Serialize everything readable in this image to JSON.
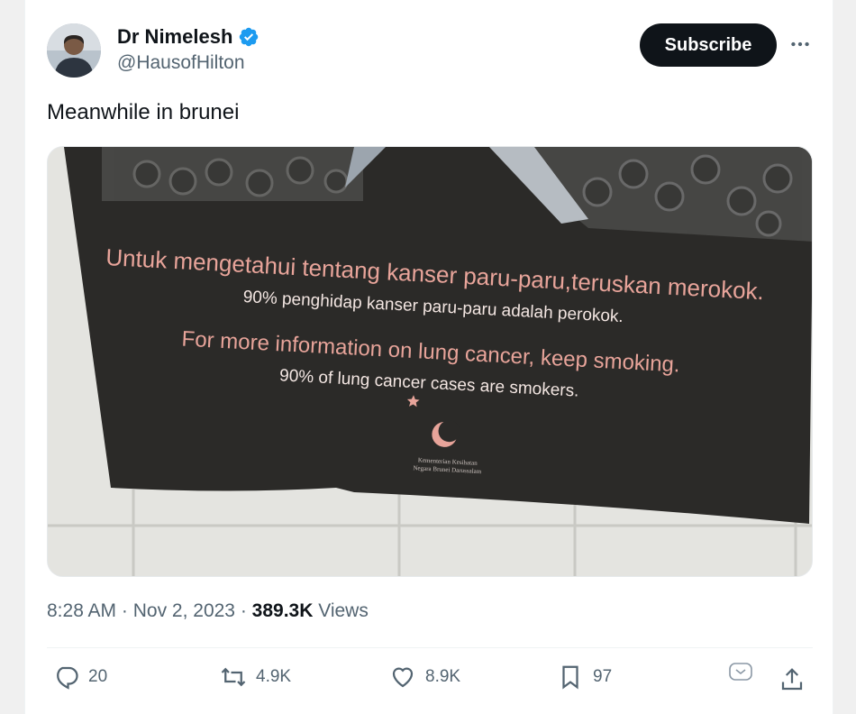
{
  "author": {
    "name": "Dr Nimelesh",
    "handle": "@HausofHilton",
    "verified_icon": "verified-badge-icon"
  },
  "header": {
    "subscribe_label": "Subscribe",
    "more_icon": "more-options-icon"
  },
  "tweet": {
    "text": "Meanwhile in brunei"
  },
  "media": {
    "poster": {
      "line1": "Untuk mengetahui tentang kanser paru-paru,teruskan merokok.",
      "line2": "90% penghidap kanser paru-paru adalah perokok.",
      "line3": "For more information on lung cancer, keep smoking.",
      "line4": "90% of lung cancer cases are smokers.",
      "ministry_line1": "Kementerian Kesihatan",
      "ministry_line2": "Negara Brunei Darussalam"
    }
  },
  "meta": {
    "time": "8:28 AM",
    "sep1": " · ",
    "date": "Nov 2, 2023",
    "sep2": " · ",
    "views_count": "389.3K",
    "views_label": " Views"
  },
  "actions": {
    "replies": "20",
    "reposts": "4.9K",
    "likes": "8.9K",
    "bookmarks": "97"
  },
  "colors": {
    "text": "#0f1419",
    "secondary": "#536471",
    "accent_blue": "#1d9bf0",
    "poster_text": "#e8a49a"
  }
}
